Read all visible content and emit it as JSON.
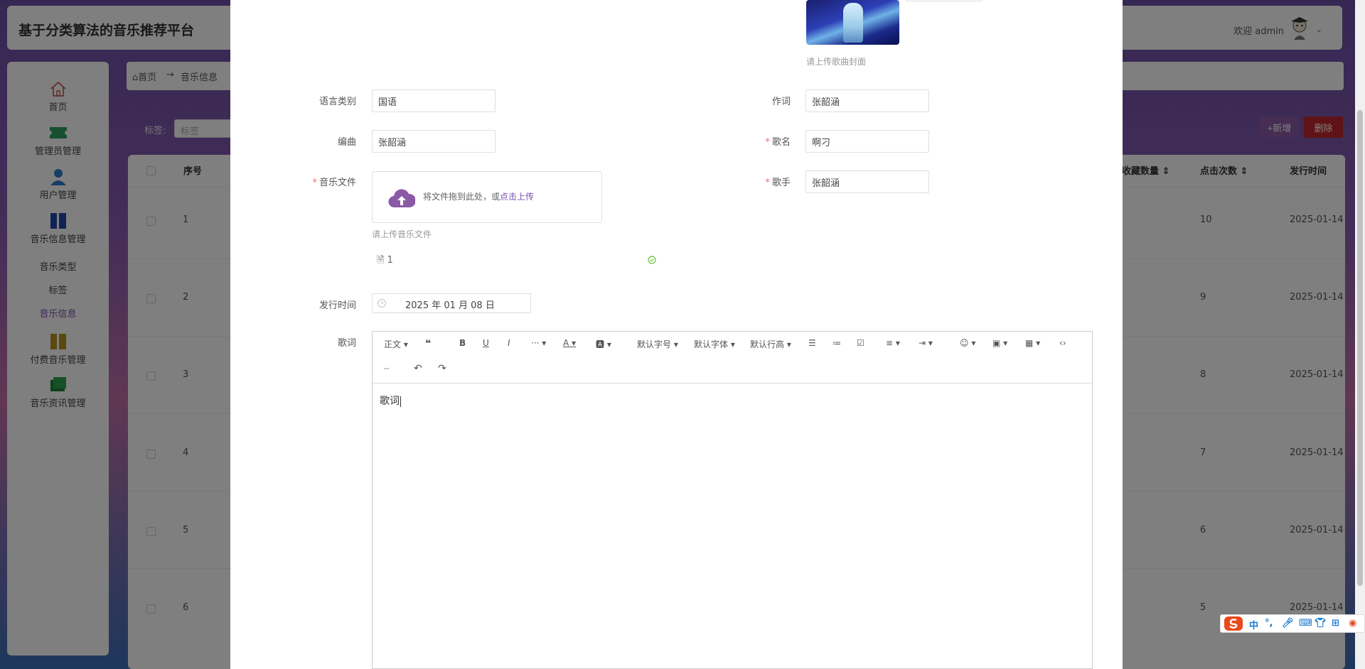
{
  "app": {
    "title": "基于分类算法的音乐推荐平台",
    "welcome": "欢迎 admin"
  },
  "sidebar": {
    "items": [
      {
        "label": "首页",
        "icon": "home-icon"
      },
      {
        "label": "管理员管理",
        "icon": "ticket-icon"
      },
      {
        "label": "用户管理",
        "icon": "user-icon"
      },
      {
        "label": "音乐信息管理",
        "icon": "book-icon"
      },
      {
        "label": "付费音乐管理",
        "icon": "book-icon"
      },
      {
        "label": "音乐资讯管理",
        "icon": "folder-icon"
      }
    ],
    "subitems": [
      {
        "label": "音乐类型",
        "active": false
      },
      {
        "label": "标签",
        "active": false
      },
      {
        "label": "音乐信息",
        "active": true
      }
    ]
  },
  "breadcrumb": {
    "home": "首页",
    "arrow": "→",
    "current": "音乐信息"
  },
  "search": {
    "label": "标签:",
    "placeholder": "标签"
  },
  "actions": {
    "add": "+新增",
    "delete": "删除"
  },
  "table": {
    "headers": {
      "index": "序号",
      "collect": "收藏数量",
      "clicks": "点击次数",
      "release": "发行时间"
    },
    "rows": [
      {
        "index": "1",
        "clicks": "10",
        "release": "2025-01-14"
      },
      {
        "index": "2",
        "clicks": "9",
        "release": "2025-01-14"
      },
      {
        "index": "3",
        "clicks": "8",
        "release": "2025-01-14"
      },
      {
        "index": "4",
        "clicks": "7",
        "release": "2025-01-14"
      },
      {
        "index": "5",
        "clicks": "6",
        "release": "2025-01-14"
      },
      {
        "index": "6",
        "clicks": "5",
        "release": "2025-01-14"
      }
    ]
  },
  "form": {
    "cover_hint": "请上传歌曲封面",
    "language": {
      "label": "语言类别",
      "value": "国语"
    },
    "lyricist": {
      "label": "作词",
      "value": "张韶涵"
    },
    "composer": {
      "label": "编曲",
      "value": "张韶涵"
    },
    "song_name": {
      "label": "歌名",
      "value": "啊刁"
    },
    "music_file": {
      "label": "音乐文件",
      "upload_text": "将文件拖到此处，或",
      "upload_link": "点击上传",
      "hint": "请上传音乐文件",
      "file_name": "1"
    },
    "singer": {
      "label": "歌手",
      "value": "张韶涵"
    },
    "release_date": {
      "label": "发行时间",
      "value": "2025 年 01 月 08 日"
    },
    "lyrics": {
      "label": "歌词",
      "content": "歌词",
      "toolbar": {
        "paragraph": "正文",
        "font_size": "默认字号",
        "font_family": "默认字体",
        "line_height": "默认行高",
        "more": "···"
      }
    }
  },
  "ime": {
    "lang": "中",
    "punct": "°,"
  },
  "colors": {
    "accent": "#7a4fb0",
    "danger": "#c0262d",
    "required": "#f56c6c"
  }
}
